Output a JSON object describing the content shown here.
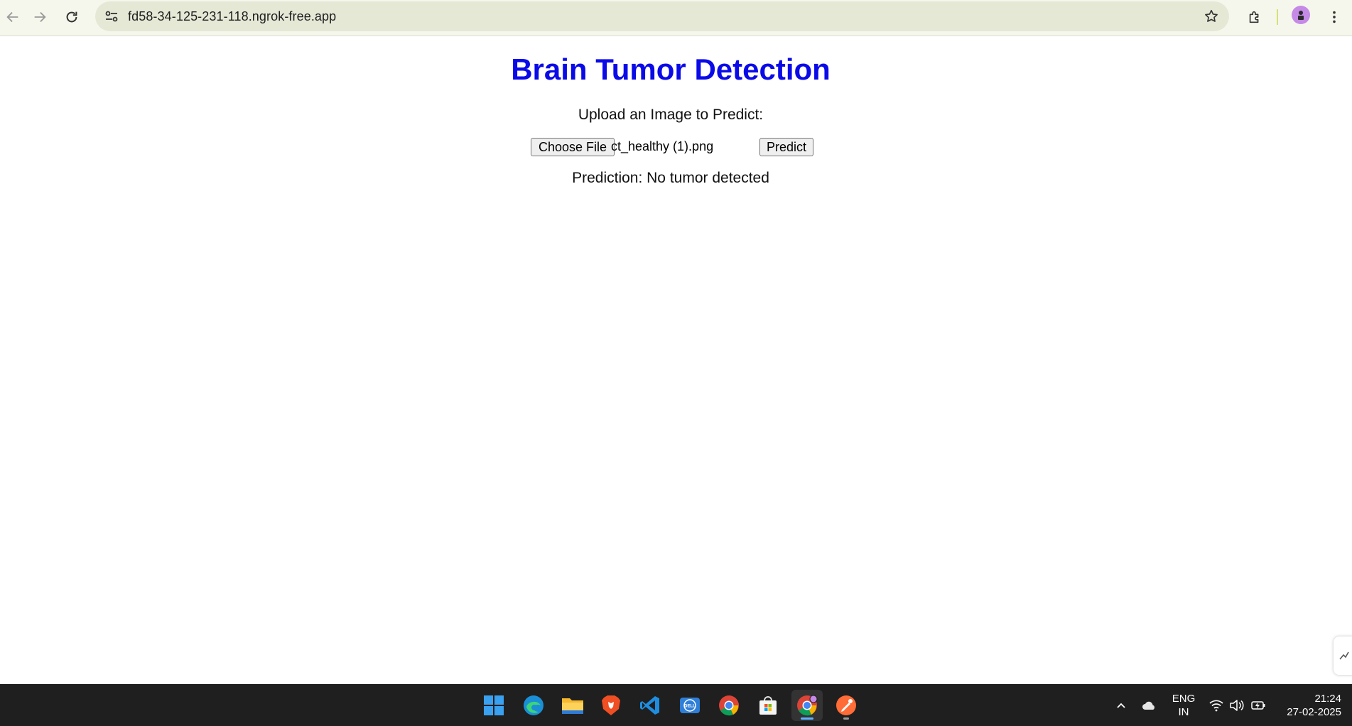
{
  "browser": {
    "url": "fd58-34-125-231-118.ngrok-free.app",
    "icons": [
      "back-icon",
      "forward-icon",
      "reload-icon",
      "site-info-icon",
      "bookmark-star-icon",
      "extensions-icon",
      "profile-avatar",
      "menu-dots-icon"
    ]
  },
  "page": {
    "title": "Brain Tumor Detection",
    "title_color": "#0a0ae8",
    "upload_label": "Upload an Image to Predict:",
    "choose_file_label": "Choose File",
    "file_name": "ct_healthy (1).png",
    "predict_label": "Predict",
    "prediction": "Prediction: No tumor detected"
  },
  "taskbar": {
    "apps": [
      "windows-start-icon",
      "edge-icon",
      "file-explorer-icon",
      "brave-icon",
      "vscode-icon",
      "dell-icon",
      "chrome-icon",
      "microsoft-store-icon",
      "chrome-profile-icon",
      "postman-icon"
    ],
    "language": "ENG",
    "region": "IN",
    "time": "21:24",
    "date": "27-02-2025"
  }
}
